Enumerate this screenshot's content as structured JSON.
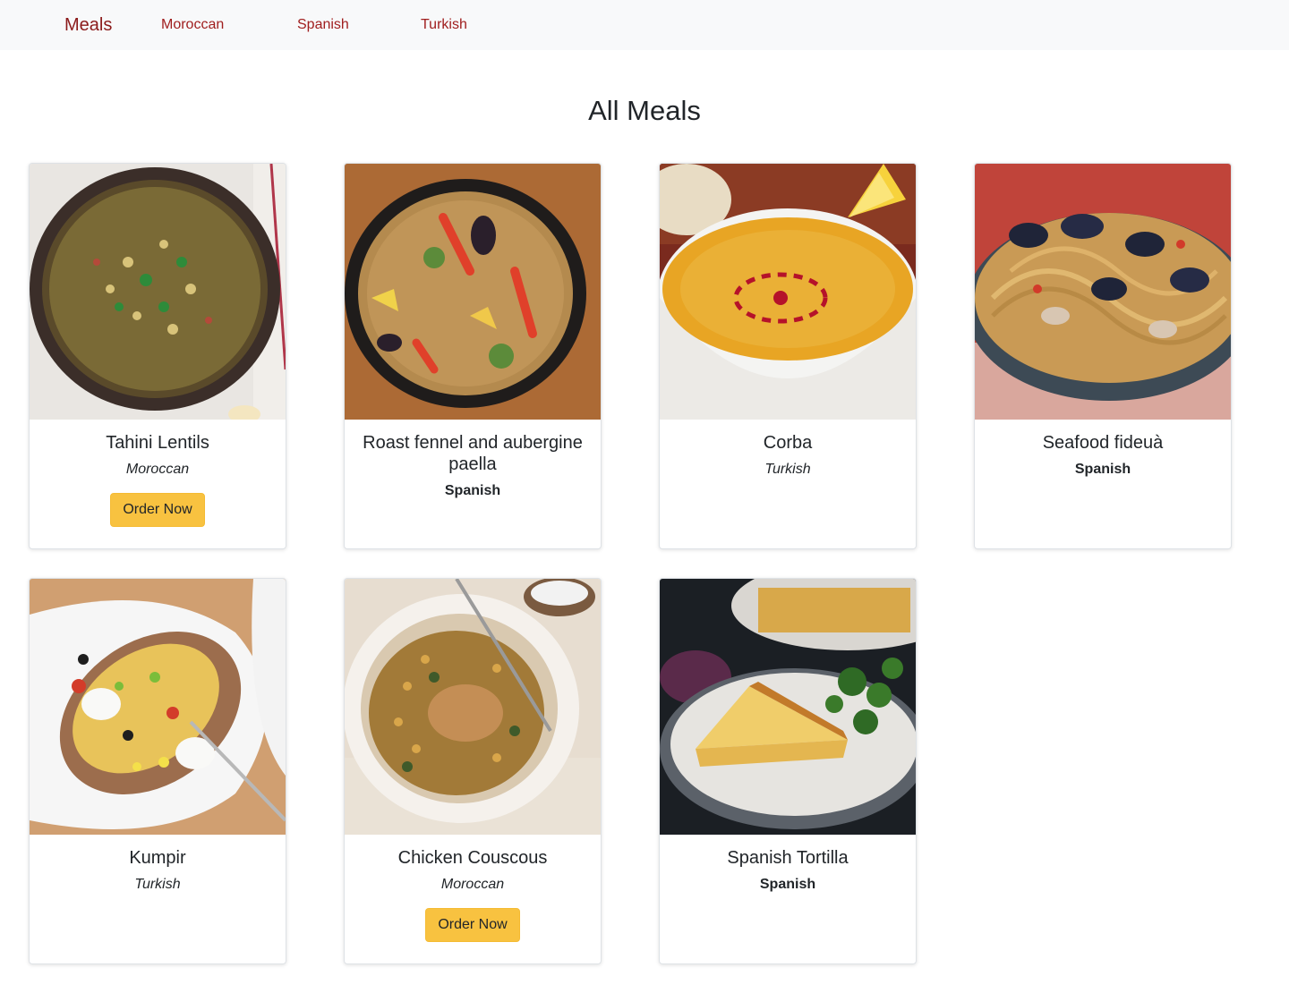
{
  "nav": {
    "brand": "Meals",
    "links": [
      "Moroccan",
      "Spanish",
      "Turkish"
    ],
    "link_color": "#a01e1e"
  },
  "page": {
    "title": "All Meals"
  },
  "colors": {
    "order_button": "#f8c240",
    "nav_background": "#f8f9fa"
  },
  "meals": [
    {
      "name": "Tahini Lentils",
      "area": "Moroccan",
      "button": "Order Now",
      "image": "lentil-dish-image"
    },
    {
      "name": "Roast fennel and aubergine paella",
      "area": "Spanish",
      "button": "",
      "image": "paella-image"
    },
    {
      "name": "Corba",
      "area": "Turkish",
      "button": "",
      "image": "soup-image"
    },
    {
      "name": "Seafood fideuà",
      "area": "Spanish",
      "button": "",
      "image": "seafood-noodles-image"
    },
    {
      "name": "Kumpir",
      "area": "Turkish",
      "button": "",
      "image": "baked-potato-image"
    },
    {
      "name": "Chicken Couscous",
      "area": "Moroccan",
      "button": "Order Now",
      "image": "couscous-image"
    },
    {
      "name": "Spanish Tortilla",
      "area": "Spanish",
      "button": "",
      "image": "tortilla-image"
    }
  ]
}
